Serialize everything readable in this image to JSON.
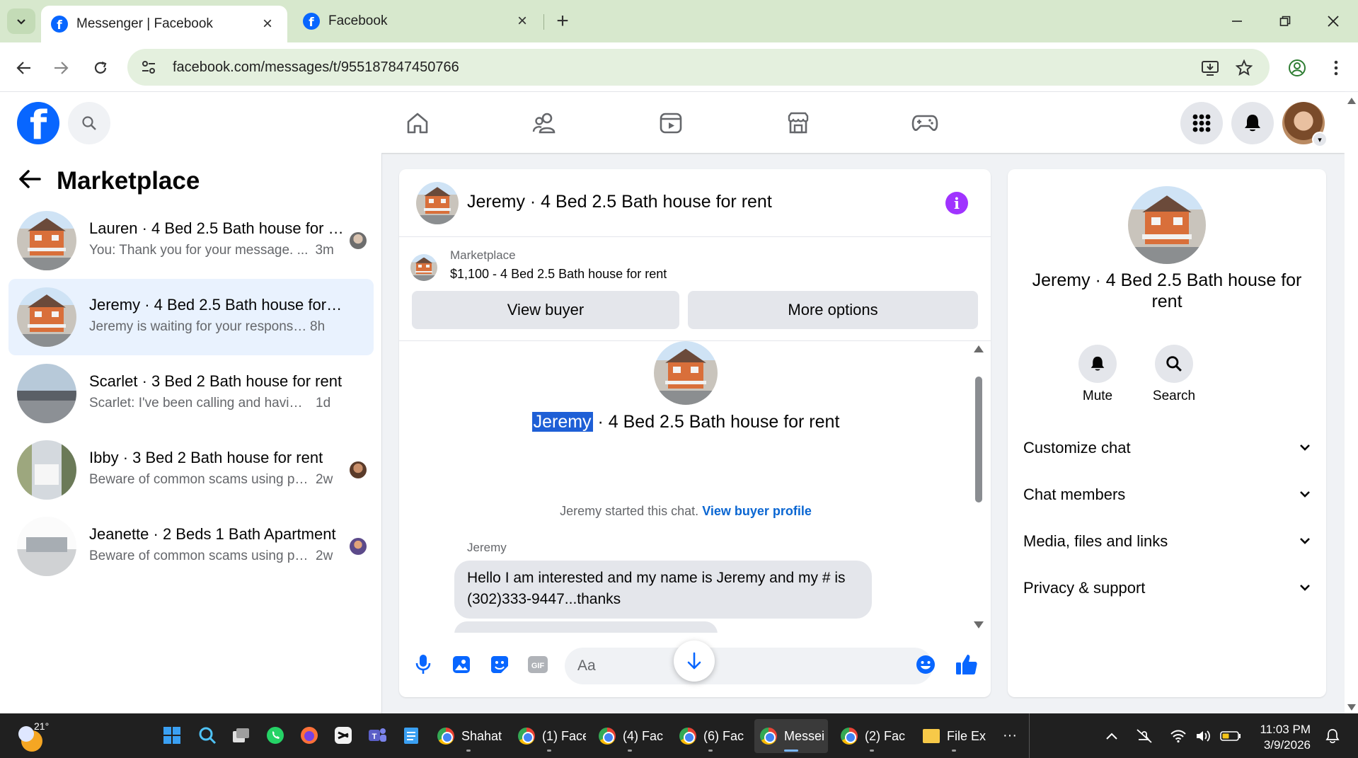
{
  "browser": {
    "tabs": [
      {
        "title": "Messenger | Facebook",
        "active": true
      },
      {
        "title": "Facebook",
        "active": false
      }
    ],
    "url": "facebook.com/messages/t/955187847450766"
  },
  "fb_header": {
    "logo": "f",
    "nav_icons": [
      "home-icon",
      "friends-icon",
      "video-icon",
      "marketplace-icon",
      "gaming-icon"
    ]
  },
  "left_panel": {
    "title": "Marketplace",
    "conversations": [
      {
        "name": "Lauren · 4 Bed 2.5 Bath house for rent",
        "preview": "You: Thank you for your message. ...",
        "time": "3m",
        "active": false
      },
      {
        "name": "Jeremy · 4 Bed 2.5 Bath house for rent",
        "preview": "Jeremy is waiting for your response. ·",
        "time": "8h",
        "active": true
      },
      {
        "name": "Scarlet · 3 Bed 2 Bath house for rent",
        "preview": "Scarlet: I've been calling and having a...",
        "time": "1d",
        "active": false
      },
      {
        "name": "Ibby · 3 Bed 2 Bath house for rent",
        "preview": "Beware of common scams using p... ·",
        "time": "2w",
        "active": false
      },
      {
        "name": "Jeanette · 2 Beds 1 Bath Apartment",
        "preview": "Beware of common scams using p... ·",
        "time": "2w",
        "active": false
      }
    ]
  },
  "chat": {
    "title": "Jeremy · 4 Bed 2.5 Bath house for rent",
    "marketplace_label": "Marketplace",
    "listing": "$1,100 - 4 Bed 2.5 Bath house for rent",
    "view_buyer": "View buyer",
    "more_options": "More options",
    "intro_name": "Jeremy",
    "intro_rest": " · 4 Bed 2.5 Bath house for rent",
    "started_text": "Jeremy started this chat.",
    "view_buyer_profile": "View buyer profile",
    "sender": "Jeremy",
    "message": "Hello I am interested and my name is Jeremy and my # is (302)333-9447...thanks",
    "composer_placeholder": "Aa"
  },
  "right_panel": {
    "title": "Jeremy · 4 Bed 2.5 Bath house for rent",
    "mute": "Mute",
    "search": "Search",
    "sections": [
      "Customize chat",
      "Chat members",
      "Media, files and links",
      "Privacy & support"
    ]
  },
  "taskbar": {
    "temperature": "21°",
    "apps": [
      {
        "label": "Shahat",
        "type": "chrome"
      },
      {
        "label": "(1) Face",
        "type": "chrome"
      },
      {
        "label": "(4) Fac",
        "type": "chrome"
      },
      {
        "label": "(6) Fac",
        "type": "chrome"
      },
      {
        "label": "Messei",
        "type": "chrome",
        "active": true
      },
      {
        "label": "(2) Fac",
        "type": "chrome"
      },
      {
        "label": "File Ex",
        "type": "folder"
      }
    ],
    "more": "···",
    "time": "11:03 PM",
    "date": "3/9/2026"
  },
  "colors": {
    "facebook_blue": "#0866ff",
    "active_conversation": "#e9f2fe",
    "info_purple": "#a033ff",
    "link_blue": "#0a66d2",
    "chrome_green": "#d7e8cd"
  }
}
